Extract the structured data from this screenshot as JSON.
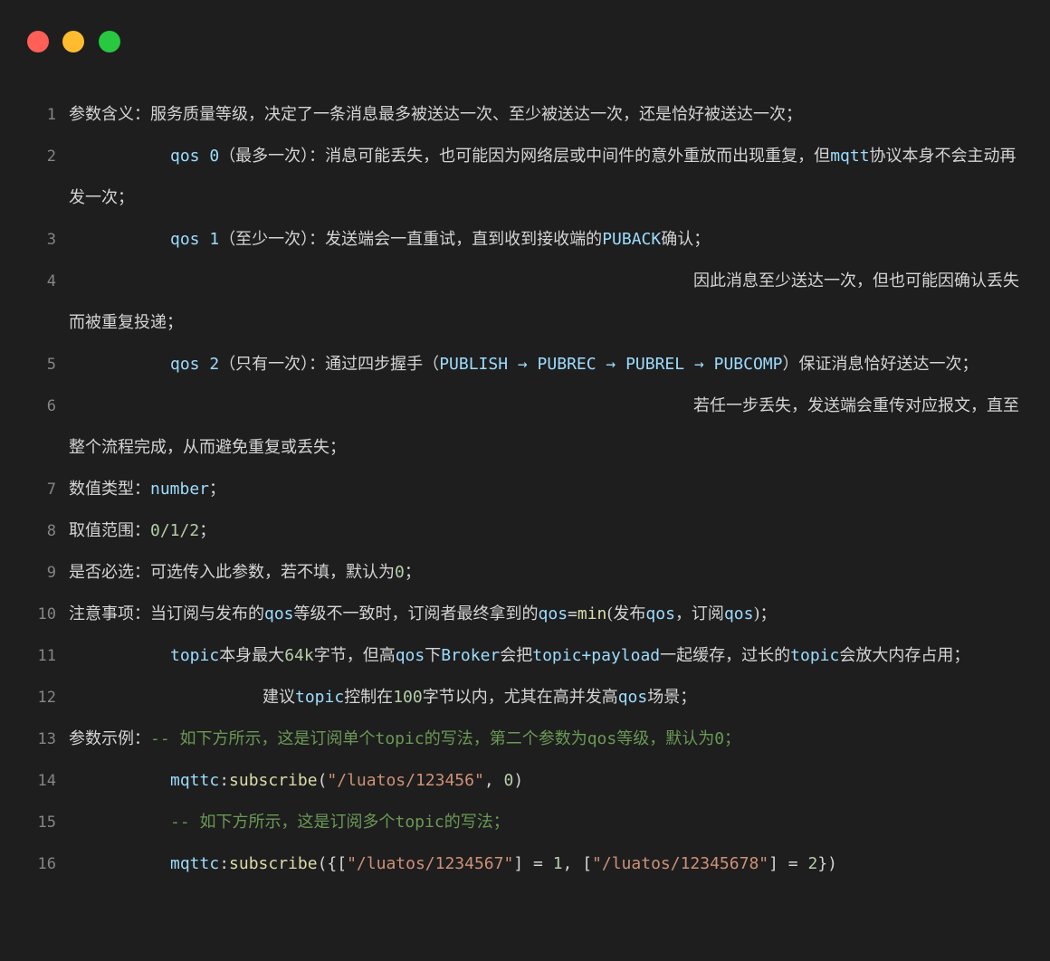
{
  "window": {
    "controls": {
      "close": "red-close-dot",
      "minimize": "yellow-minimize-dot",
      "maximize": "green-maximize-dot"
    }
  },
  "colors": {
    "background": "#1e1e1e",
    "text": "#d4d4d4",
    "line_number": "#858585",
    "keyword": "#9cdcfe",
    "number": "#b5cea8",
    "string": "#ce9178",
    "comment": "#6a9955"
  },
  "lines": [
    {
      "n": "1",
      "text": "参数含义：服务质量等级，决定了一条消息最多被送达一次、至少被送达一次，还是恰好被送达一次；"
    },
    {
      "n": "2",
      "qos": "qos 0",
      "text": "（最多一次）：消息可能丢失，也可能因为网络层或中间件的意外重放而出现重复，但",
      "mqtt": "mqtt",
      "text2": "协议本身不会主动再发一次；"
    },
    {
      "n": "3",
      "qos": "qos 1",
      "text": "（至少一次）：发送端会一直重试，直到收到接收端的",
      "puback": "PUBACK",
      "text2": "确认；"
    },
    {
      "n": "4",
      "text": "因此消息至少送达一次，但也可能因确认丢失",
      "text2": "而被重复投递；"
    },
    {
      "n": "5",
      "qos": "qos 2",
      "text": "（只有一次）：通过四步握手（",
      "flow": "PUBLISH → PUBREC → PUBREL → PUBCOMP",
      "text2": "）保证消息恰好送达一次；"
    },
    {
      "n": "6",
      "text": "若任一步丢失，发送端会重传对应报文，直至",
      "text2": "整个流程完成，从而避免重复或丢失；"
    },
    {
      "n": "7",
      "label": "数值类型：",
      "value": "number",
      "tail": "；"
    },
    {
      "n": "8",
      "label": "取值范围：",
      "value": "0/1/2",
      "tail": "；"
    },
    {
      "n": "9",
      "label": "是否必选：可选传入此参数，若不填，默认为",
      "value": "0",
      "tail": "；"
    },
    {
      "n": "10",
      "a": "注意事项：当订阅与发布的",
      "b": "qos",
      "c": "等级不一致时，订阅者最终拿到的",
      "d": "qos",
      "e": "=",
      "f": "min",
      "g": "(发布",
      "h": "qos",
      "i": "，订阅",
      "j": "qos",
      "k": ")；"
    },
    {
      "n": "11",
      "a": "topic",
      "b": "本身最大",
      "c": "64k",
      "d": "字节，但高",
      "e": "qos",
      "f": "下",
      "g": "Broker",
      "h": "会把",
      "i": "topic+payload",
      "j": "一起缓存，过长的",
      "k": "topic",
      "l": "会放大内存占用；"
    },
    {
      "n": "12",
      "a": "建议",
      "b": "topic",
      "c": "控制在",
      "d": "100",
      "e": "字节以内，尤其在高并发高",
      "f": "qos",
      "g": "场景；"
    },
    {
      "n": "13",
      "label": "参数示例：",
      "comment": "-- 如下方所示，这是订阅单个topic的写法，第二个参数为qos等级，默认为0；"
    },
    {
      "n": "14",
      "obj": "mqttc",
      "sep": ":",
      "fn": "subscribe",
      "open": "(",
      "str": "\"/luatos/123456\"",
      "comma": ", ",
      "num": "0",
      "close": ")"
    },
    {
      "n": "15",
      "comment": "-- 如下方所示，这是订阅多个topic的写法；"
    },
    {
      "n": "16",
      "obj": "mqttc",
      "sep": ":",
      "fn": "subscribe",
      "open": "({[",
      "str1": "\"/luatos/1234567\"",
      "eq1": "] = ",
      "num1": "1",
      "mid": ", [",
      "str2": "\"/luatos/12345678\"",
      "eq2": "] = ",
      "num2": "2",
      "close": "})"
    }
  ]
}
